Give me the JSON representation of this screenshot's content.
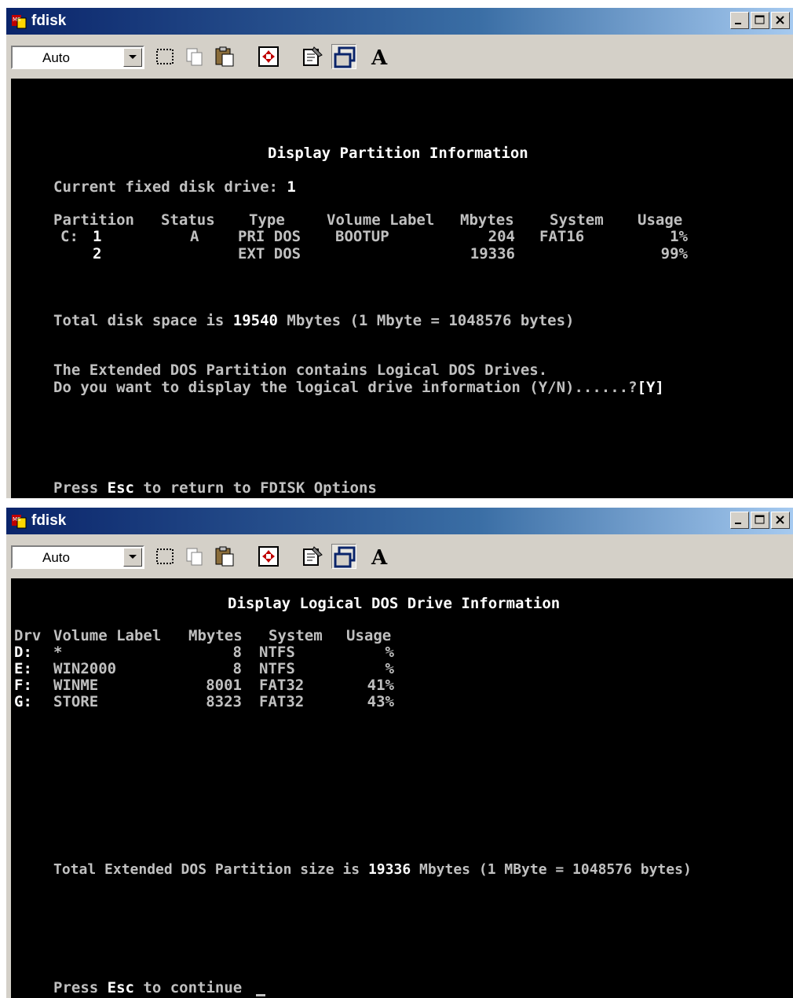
{
  "windows": [
    {
      "title": "fdisk",
      "toolbar": {
        "font_size": "Auto",
        "font_button_label": "A"
      },
      "console": {
        "heading": "Display Partition Information",
        "drive_prefix": "Current fixed disk drive: ",
        "drive_number": "1",
        "headers": [
          "Partition",
          "Status",
          "Type",
          "Volume Label",
          "Mbytes",
          "System",
          "Usage"
        ],
        "rows": [
          {
            "drive": "C:",
            "partition": "1",
            "status": "A",
            "type": "PRI DOS",
            "label": "BOOTUP",
            "mbytes": "204",
            "system": "FAT16",
            "usage": "1%"
          },
          {
            "drive": "",
            "partition": "2",
            "status": "",
            "type": "EXT DOS",
            "label": "",
            "mbytes": "19336",
            "system": "",
            "usage": "99%"
          }
        ],
        "total_prefix": "Total disk space is ",
        "total_value": "19540",
        "total_suffix": " Mbytes (1 Mbyte = 1048576 bytes)",
        "ext_line": "The Extended DOS Partition contains Logical DOS Drives.",
        "prompt_line": "Do you want to display the logical drive information (Y/N)......?",
        "prompt_answer": "[Y]",
        "footer_prefix": "Press ",
        "footer_key": "Esc",
        "footer_suffix": " to return to FDISK Options"
      }
    },
    {
      "title": "fdisk",
      "toolbar": {
        "font_size": "Auto",
        "font_button_label": "A"
      },
      "console": {
        "heading": "Display Logical DOS Drive Information",
        "headers": [
          "Drv",
          "Volume Label",
          "Mbytes",
          "System",
          "Usage"
        ],
        "rows": [
          {
            "drv": "D:",
            "label": "*",
            "mbytes": "8",
            "system": "NTFS",
            "usage": "%"
          },
          {
            "drv": "E:",
            "label": "WIN2000",
            "mbytes": "8",
            "system": "NTFS",
            "usage": "%"
          },
          {
            "drv": "F:",
            "label": "WINME",
            "mbytes": "8001",
            "system": "FAT32",
            "usage": "41%"
          },
          {
            "drv": "G:",
            "label": "STORE",
            "mbytes": "8323",
            "system": "FAT32",
            "usage": "43%"
          }
        ],
        "total_prefix": "Total Extended DOS Partition size is ",
        "total_value": "19336",
        "total_suffix": " Mbytes (1 MByte = 1048576 bytes)",
        "footer_prefix": "Press ",
        "footer_key": "Esc",
        "footer_suffix": " to continue"
      }
    }
  ]
}
